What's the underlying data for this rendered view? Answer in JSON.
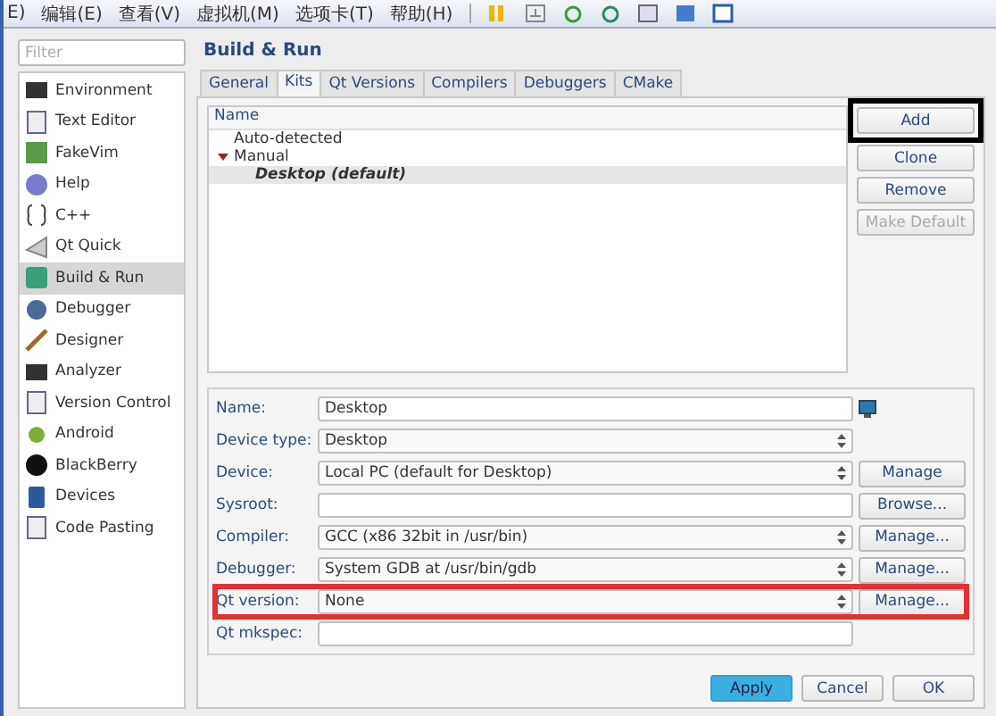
{
  "menu_bar": {
    "items": [
      "E)",
      "编辑(E)",
      "查看(V)",
      "虚拟机(M)",
      "选项卡(T)",
      "帮助(H)"
    ]
  },
  "sidebar": {
    "filter": {
      "placeholder": "Filter"
    },
    "items": [
      {
        "label": "Environment",
        "selected": false
      },
      {
        "label": "Text Editor",
        "selected": false
      },
      {
        "label": "FakeVim",
        "selected": false
      },
      {
        "label": "Help",
        "selected": false
      },
      {
        "label": "C++",
        "selected": false
      },
      {
        "label": "Qt Quick",
        "selected": false
      },
      {
        "label": "Build & Run",
        "selected": true
      },
      {
        "label": "Debugger",
        "selected": false
      },
      {
        "label": "Designer",
        "selected": false
      },
      {
        "label": "Analyzer",
        "selected": false
      },
      {
        "label": "Version Control",
        "selected": false
      },
      {
        "label": "Android",
        "selected": false
      },
      {
        "label": "BlackBerry",
        "selected": false
      },
      {
        "label": "Devices",
        "selected": false
      },
      {
        "label": "Code Pasting",
        "selected": false
      }
    ]
  },
  "page": {
    "title": "Build & Run"
  },
  "tabs": [
    {
      "label": "General",
      "selected": false
    },
    {
      "label": "Kits",
      "selected": true
    },
    {
      "label": "Qt Versions",
      "selected": false
    },
    {
      "label": "Compilers",
      "selected": false
    },
    {
      "label": "Debuggers",
      "selected": false
    },
    {
      "label": "CMake",
      "selected": false
    }
  ],
  "kit_tree": {
    "column": "Name",
    "items": [
      {
        "label": "Auto-detected",
        "selected": false
      },
      {
        "label": "Manual",
        "selected": false,
        "expanded": true,
        "children": [
          {
            "label": "Desktop (default)",
            "selected": true
          }
        ]
      }
    ]
  },
  "kit_buttons": [
    {
      "label": "Add",
      "disabled": false,
      "color": "#000000"
    },
    {
      "label": "Clone",
      "disabled": false
    },
    {
      "label": "Remove",
      "disabled": false
    },
    {
      "label": "Make Default",
      "disabled": true
    }
  ],
  "form": [
    {
      "label": "Name:",
      "kind": "name",
      "value": "Desktop"
    },
    {
      "label": "Device type:",
      "kind": "combo",
      "value": "Desktop"
    },
    {
      "label": "Device:",
      "kind": "combo",
      "value": "Local PC (default for Desktop)",
      "button": "Manage"
    },
    {
      "label": "Sysroot:",
      "kind": "input",
      "button": "Browse..."
    },
    {
      "label": "Compiler:",
      "kind": "combo",
      "value": "GCC (x86 32bit in /usr/bin)",
      "button": "Manage..."
    },
    {
      "label": "Debugger:",
      "kind": "combo",
      "value": "System GDB at /usr/bin/gdb",
      "button": "Manage..."
    },
    {
      "label": "Qt version:",
      "kind": "combo",
      "value": "None",
      "button": "Manage...",
      "color": "#e53030"
    },
    {
      "label": "Qt mkspec:",
      "kind": "input"
    }
  ],
  "dialog_buttons": [
    {
      "label": "Apply",
      "default": true
    },
    {
      "label": "Cancel",
      "default": false
    },
    {
      "label": "OK",
      "default": false
    }
  ]
}
